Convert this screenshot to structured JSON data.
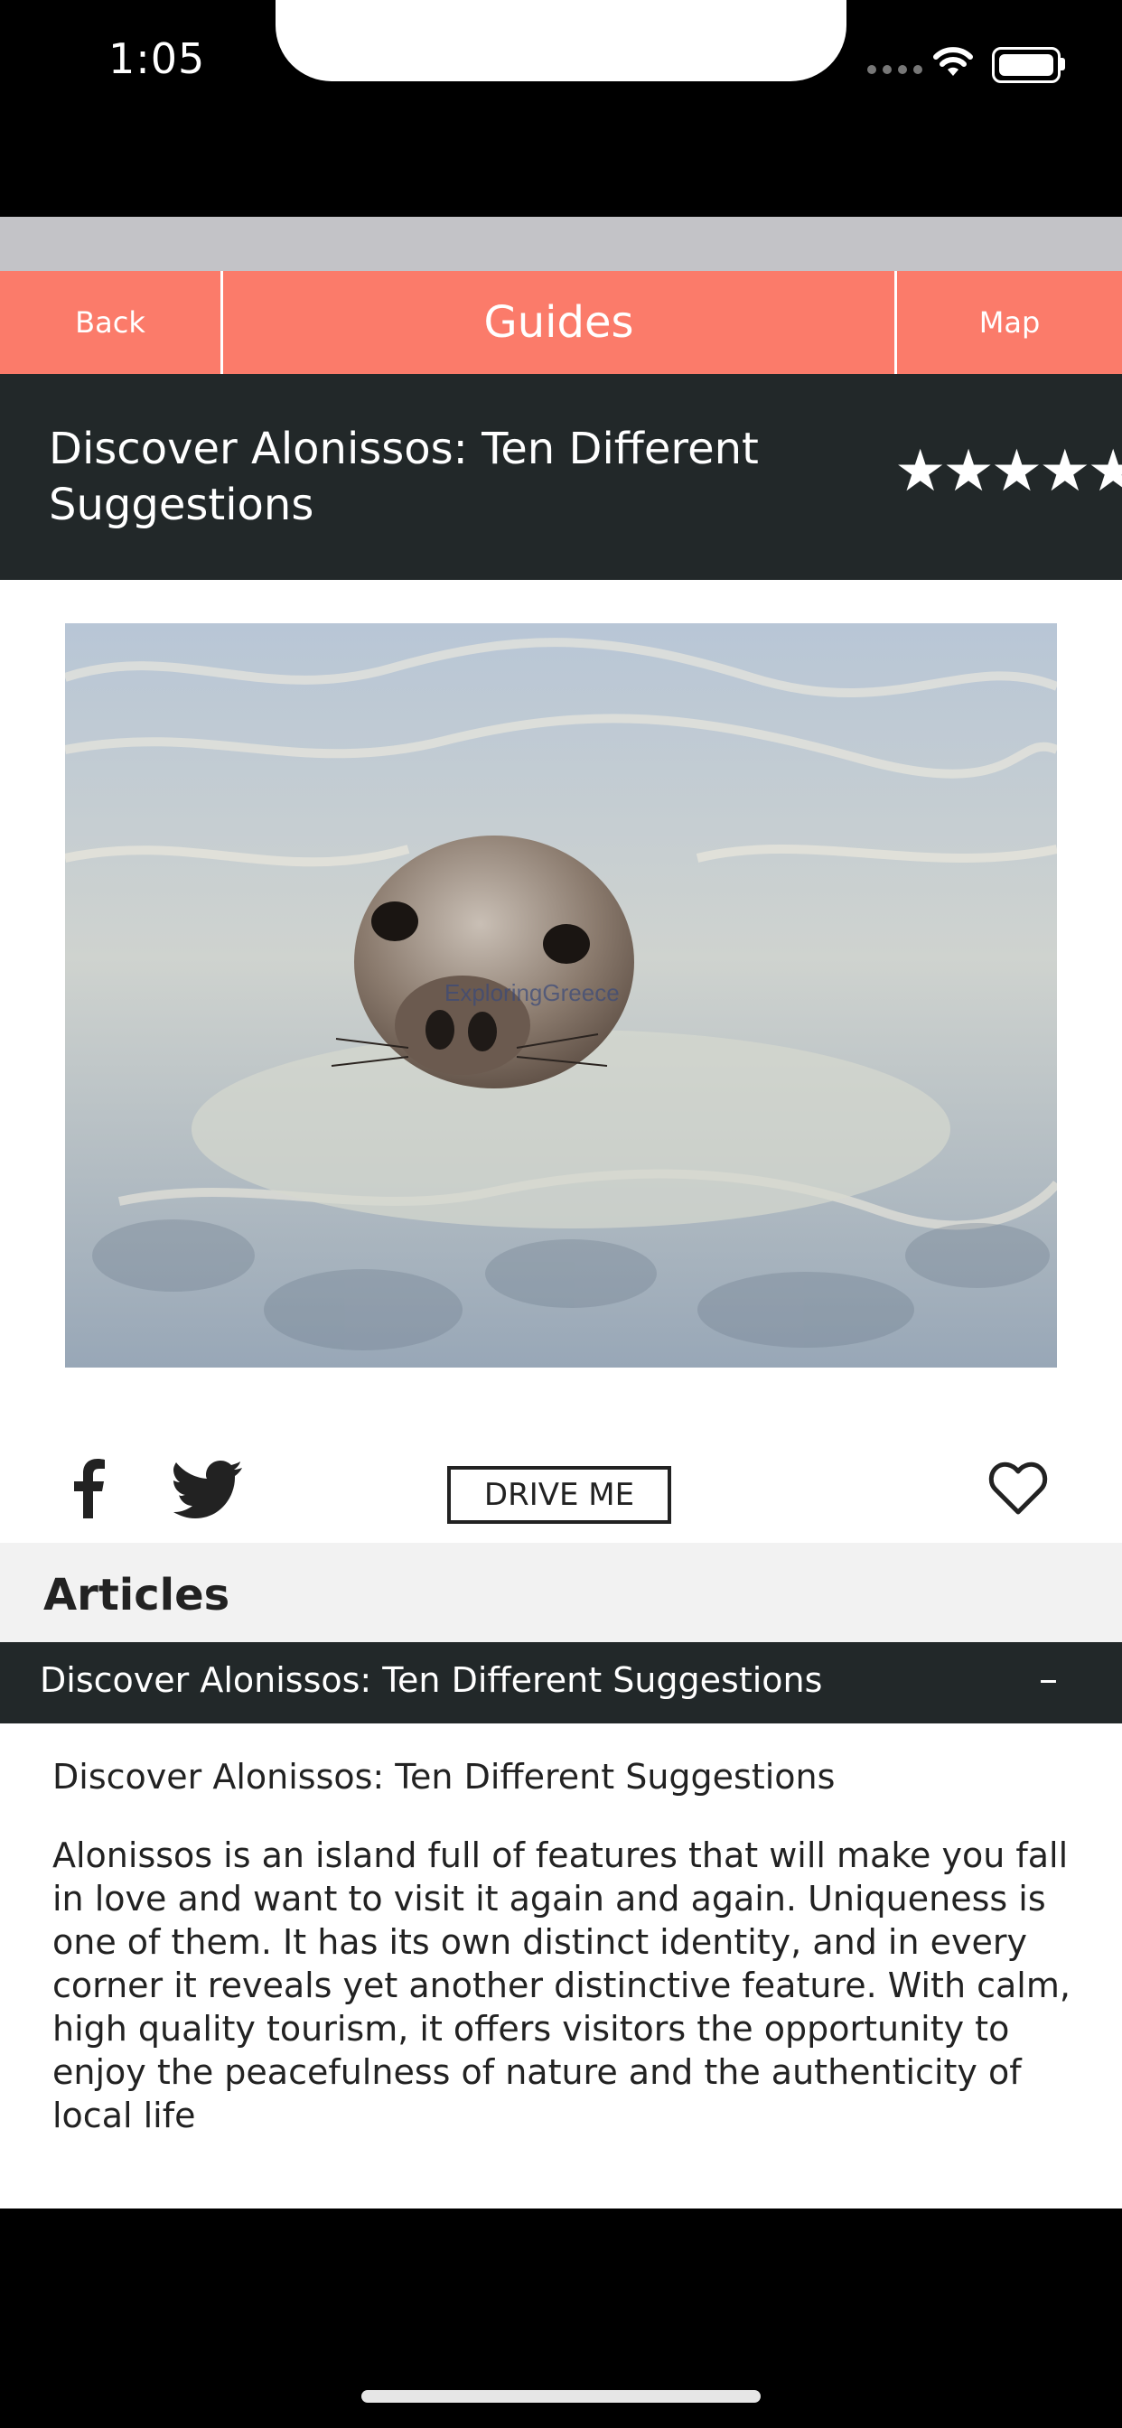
{
  "status_bar": {
    "time": "1:05"
  },
  "nav": {
    "back_label": "Back",
    "title": "Guides",
    "map_label": "Map"
  },
  "header": {
    "title": "Discover Alonissos: Ten Different Suggestions",
    "rating": "★★★★★",
    "rating_value": 5
  },
  "hero": {
    "alt": "Seal swimming in clear water",
    "watermark": "ExploringGreece"
  },
  "actions": {
    "drive_label": "DRIVE ME"
  },
  "articles": {
    "heading": "Articles",
    "accordion_title": "Discover Alonissos: Ten Different Suggestions",
    "toggle": "–",
    "subtitle": "Discover Alonissos: Ten Different Suggestions",
    "body": "Alonissos is an island full of features that will make you fall in love and want to visit it again and again. Uniqueness is one of them. It has its own distinct identity, and in every corner it reveals yet another distinctive feature. With calm, high quality tourism, it offers visitors the opportunity to enjoy the peacefulness of nature and the authenticity of local life"
  },
  "tabbar": {
    "items": [
      {
        "icon": "home-icon"
      },
      {
        "icon": "heart-icon"
      },
      {
        "icon": "location-pin-icon"
      },
      {
        "icon": "search-icon"
      },
      {
        "icon": "menu-icon"
      }
    ]
  },
  "colors": {
    "nav_bg": "#fb7b6a",
    "dark_band": "#222829",
    "articles_bg": "#f2f2f2"
  }
}
